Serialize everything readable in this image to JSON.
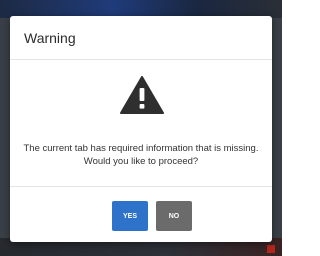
{
  "background": {
    "bottom_label": "▯ ▯ ▯▯▯ ▯▯▯▯"
  },
  "dialog": {
    "title": "Warning",
    "icon": "warning-triangle-icon",
    "message": "The current tab has required information that is missing. Would you like to proceed?",
    "yes_label": "YES",
    "no_label": "NO"
  },
  "colors": {
    "yes_button": "#2e73c9",
    "no_button": "#6b6b6b",
    "icon": "#2f2f2f"
  }
}
